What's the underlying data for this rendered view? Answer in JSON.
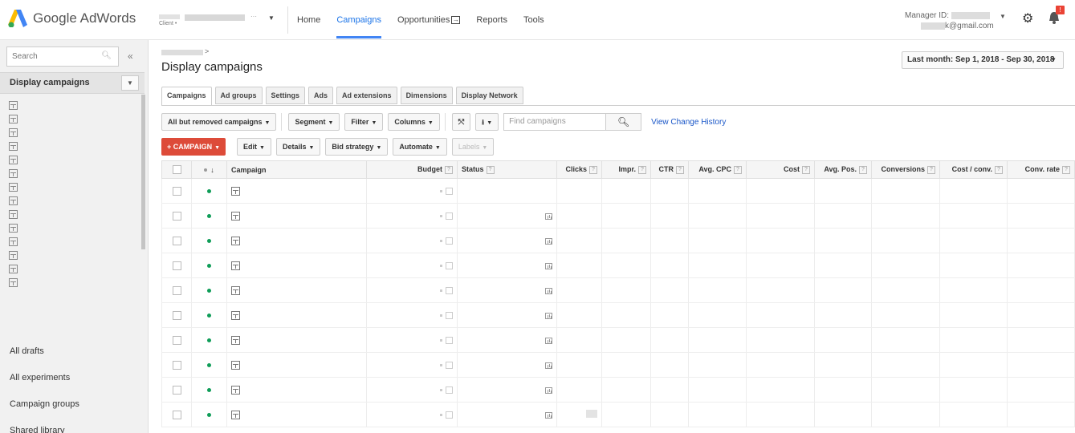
{
  "app": {
    "name": "Google AdWords"
  },
  "client": {
    "label": "Client •",
    "dots": "···"
  },
  "nav": {
    "items": [
      "Home",
      "Campaigns",
      "Opportunities",
      "Reports",
      "Tools"
    ],
    "active": "Campaigns"
  },
  "account": {
    "manager_label": "Manager ID:",
    "email_suffix": "k@gmail.com",
    "notification_count": "!"
  },
  "colors": {
    "accent": "#4285f4",
    "brand_red": "#dd4b39",
    "status_green": "#0f9d58",
    "link": "#1a57c8"
  },
  "sidebar": {
    "search_placeholder": "Search",
    "collapse_icon": "«",
    "header": "Display campaigns",
    "item_count": 14,
    "links": [
      "All drafts",
      "All experiments",
      "Campaign groups",
      "Shared library"
    ]
  },
  "page": {
    "breadcrumb_arrow": ">",
    "title": "Display campaigns",
    "date_range": "Last month: Sep 1, 2018 - Sep 30, 2018"
  },
  "tabs": [
    "Campaigns",
    "Ad groups",
    "Settings",
    "Ads",
    "Ad extensions",
    "Dimensions",
    "Display Network"
  ],
  "toolbar": {
    "filter_view": "All but removed campaigns",
    "segment": "Segment",
    "filter": "Filter",
    "columns": "Columns",
    "find_placeholder": "Find campaigns",
    "view_history": "View Change History",
    "campaign_button": "+ CAMPAIGN",
    "edit": "Edit",
    "details": "Details",
    "bid_strategy": "Bid strategy",
    "automate": "Automate",
    "labels": "Labels"
  },
  "table": {
    "columns": [
      "Campaign",
      "Budget",
      "Status",
      "Clicks",
      "Impr.",
      "CTR",
      "Avg. CPC",
      "Cost",
      "Avg. Pos.",
      "Conversions",
      "Cost / conv.",
      "Conv. rate"
    ],
    "row_count": 10
  }
}
